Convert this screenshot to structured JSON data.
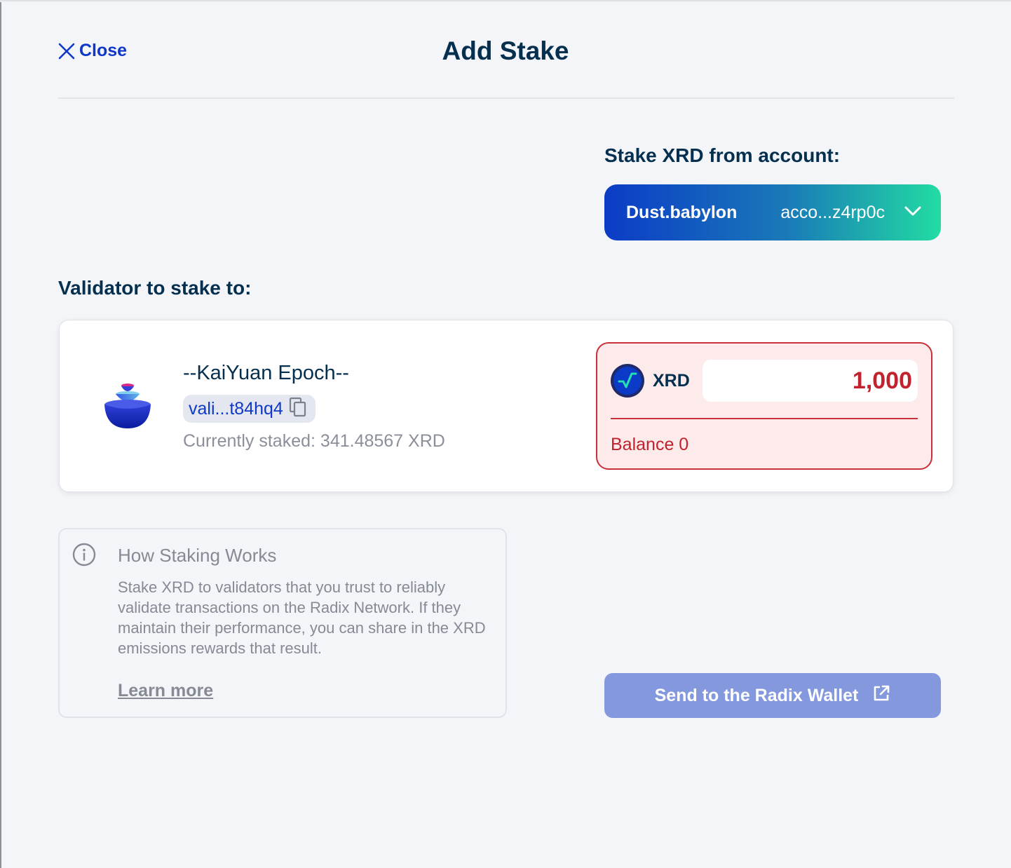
{
  "header": {
    "close_label": "Close",
    "title": "Add Stake"
  },
  "account": {
    "label": "Stake XRD from account:",
    "name": "Dust.babylon",
    "address": "acco...z4rp0c"
  },
  "validator": {
    "label": "Validator to stake to:",
    "name": "--KaiYuan Epoch--",
    "address": "vali...t84hq4",
    "currently_staked": "Currently staked: 341.48567 XRD"
  },
  "amount": {
    "token": "XRD",
    "value": "1,000",
    "balance": "Balance 0"
  },
  "info": {
    "title": "How Staking Works",
    "text": "Stake XRD to validators that you trust to reliably validate transactions on the Radix Network. If they maintain their performance, you can share in the XRD emissions rewards that result.",
    "learn_more": "Learn more"
  },
  "send_button": {
    "label": "Send to the Radix Wallet"
  },
  "colors": {
    "accent_blue": "#1038c8",
    "navy_text": "#052f4e",
    "error_red": "#c0232d",
    "send_button_bg": "#8498de"
  }
}
